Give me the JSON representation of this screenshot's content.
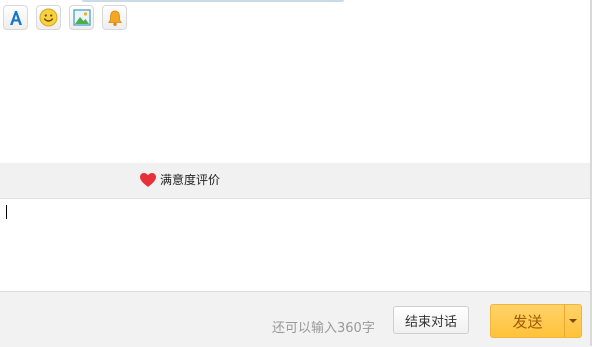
{
  "toolbar": {
    "rating_label": "满意度评价",
    "icons": [
      "font-icon",
      "emoji-icon",
      "image-icon",
      "bell-icon",
      "heart-icon"
    ]
  },
  "footer": {
    "char_count": "还可以输入360字",
    "end_chat_label": "结束对话",
    "send_label": "发送"
  },
  "colors": {
    "accent": "#ffc23a",
    "font_icon": "#1a76c6",
    "heart": "#e8303a"
  }
}
